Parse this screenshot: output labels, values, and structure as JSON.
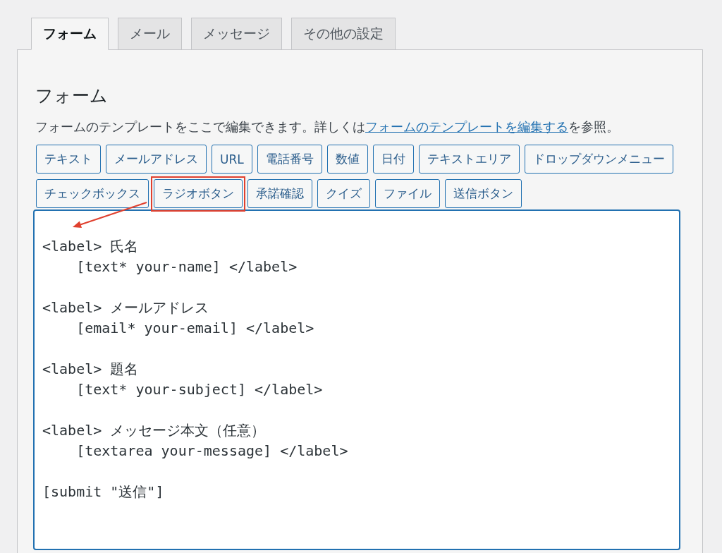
{
  "tabs": [
    {
      "label": "フォーム",
      "selected": true
    },
    {
      "label": "メール",
      "selected": false
    },
    {
      "label": "メッセージ",
      "selected": false
    },
    {
      "label": "その他の設定",
      "selected": false
    }
  ],
  "panel": {
    "heading": "フォーム",
    "description": {
      "before": "フォームのテンプレートをここで編集できます。詳しくは",
      "link": "フォームのテンプレートを編集する",
      "after": "を参照。"
    },
    "tag_buttons": [
      {
        "label": "テキスト",
        "highlighted": false
      },
      {
        "label": "メールアドレス",
        "highlighted": false
      },
      {
        "label": "URL",
        "highlighted": false
      },
      {
        "label": "電話番号",
        "highlighted": false
      },
      {
        "label": "数値",
        "highlighted": false
      },
      {
        "label": "日付",
        "highlighted": false
      },
      {
        "label": "テキストエリア",
        "highlighted": false
      },
      {
        "label": "ドロップダウンメニュー",
        "highlighted": false
      },
      {
        "label": "チェックボックス",
        "highlighted": false
      },
      {
        "label": "ラジオボタン",
        "highlighted": true
      },
      {
        "label": "承諾確認",
        "highlighted": false
      },
      {
        "label": "クイズ",
        "highlighted": false
      },
      {
        "label": "ファイル",
        "highlighted": false
      },
      {
        "label": "送信ボタン",
        "highlighted": false
      }
    ],
    "template": {
      "value": "<label> 氏名\n    [text* your-name] </label>\n\n<label> メールアドレス\n    [email* your-email] </label>\n\n<label> 題名\n    [text* your-subject] </label>\n\n<label> メッセージ本文（任意）\n    [textarea your-message] </label>\n\n[submit \"送信\"]"
    }
  }
}
